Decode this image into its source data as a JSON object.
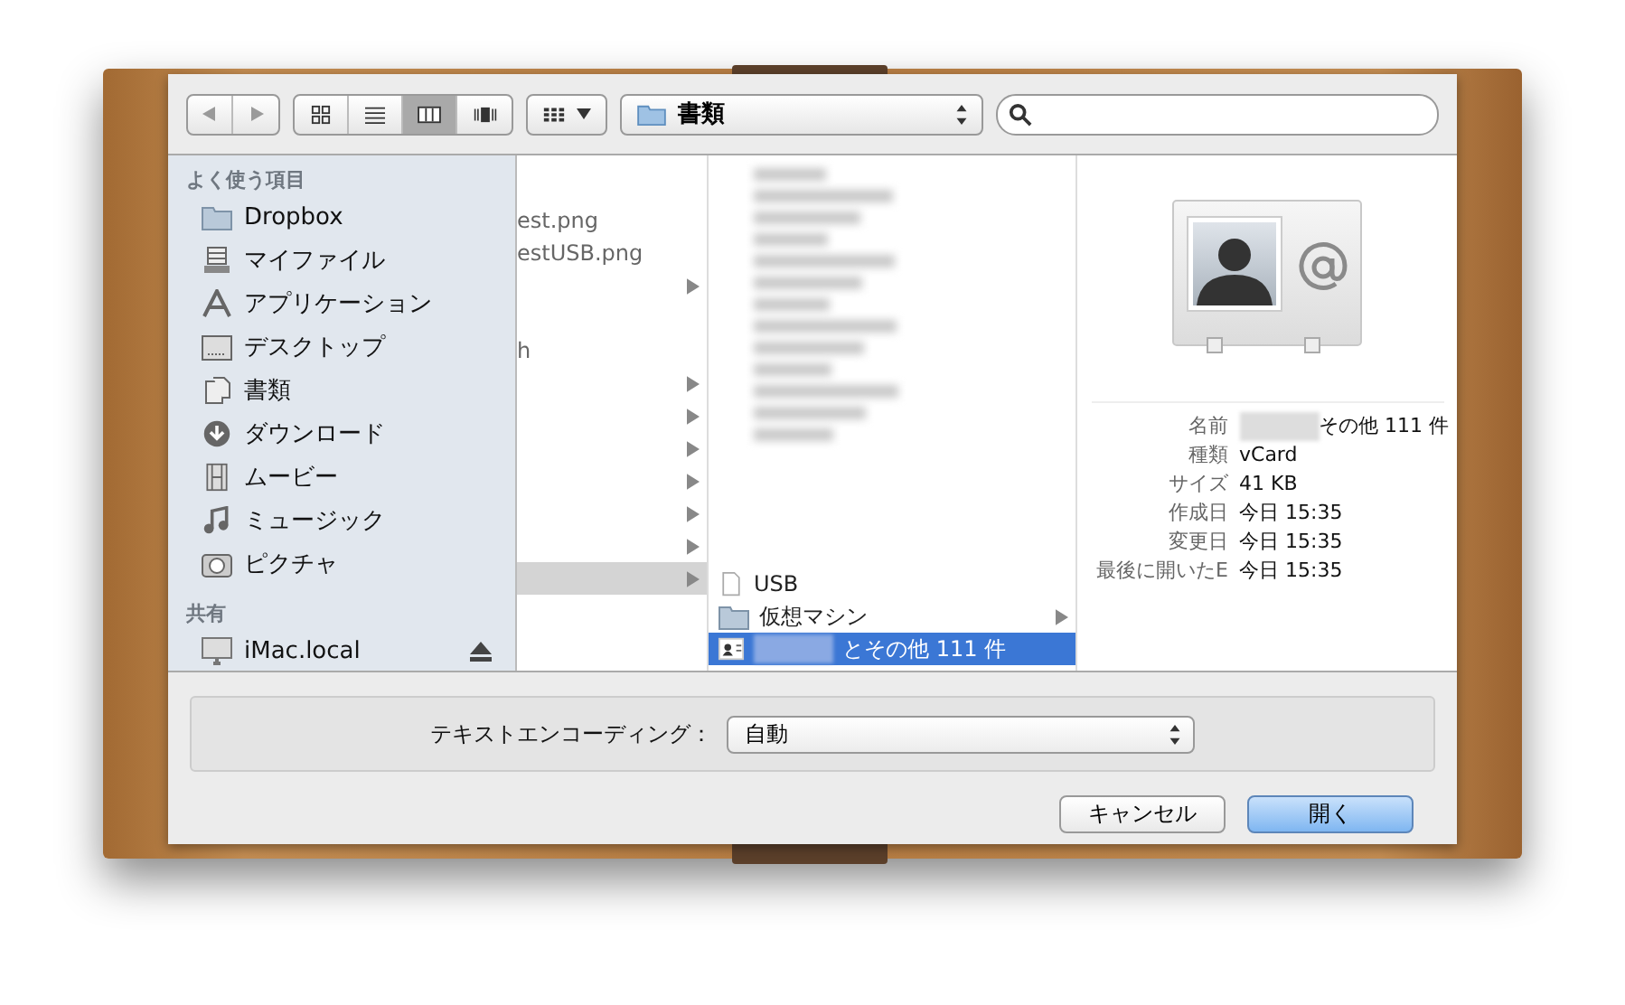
{
  "toolbar": {
    "nav_buttons": [
      {
        "kind": "back",
        "disabled": true
      },
      {
        "kind": "forward",
        "disabled": true
      }
    ],
    "view_modes": [
      {
        "kind": "icons",
        "selected": false
      },
      {
        "kind": "list",
        "selected": false
      },
      {
        "kind": "columns",
        "selected": true
      },
      {
        "kind": "coverflow",
        "selected": false
      }
    ],
    "path_popup": "書類"
  },
  "sidebar": {
    "sections": [
      {
        "title": "よく使う項目",
        "items": [
          {
            "label": "Dropbox",
            "kind": "folder"
          },
          {
            "label": "マイファイル",
            "kind": "myfiles"
          },
          {
            "label": "アプリケーション",
            "kind": "apps"
          },
          {
            "label": "デスクトップ",
            "kind": "desktop"
          },
          {
            "label": "書類",
            "kind": "documents"
          },
          {
            "label": "ダウンロード",
            "kind": "download"
          },
          {
            "label": "ムービー",
            "kind": "movie"
          },
          {
            "label": "ミュージック",
            "kind": "music"
          },
          {
            "label": "ピクチャ",
            "kind": "camera"
          }
        ]
      },
      {
        "title": "共有",
        "items": [
          {
            "label": "iMac.local",
            "kind": "display",
            "eject": true
          }
        ]
      }
    ]
  },
  "columns": [
    {
      "focused": false,
      "items": [
        {
          "kind": "file",
          "text": "est.png",
          "has_arrow": false,
          "selected": false
        },
        {
          "kind": "file",
          "text": "estUSB.png",
          "has_arrow": false,
          "selected": false
        },
        {
          "kind": "file",
          "has_arrow": true,
          "selected": false
        },
        {
          "kind": "blank"
        },
        {
          "kind": "file",
          "text": "h",
          "has_arrow": false,
          "selected": false
        },
        {
          "kind": "file",
          "has_arrow": true,
          "selected": false
        },
        {
          "kind": "file",
          "has_arrow": true,
          "selected": false
        },
        {
          "kind": "file",
          "has_arrow": true,
          "selected": false
        },
        {
          "kind": "file",
          "has_arrow": true,
          "selected": false
        },
        {
          "kind": "file",
          "has_arrow": true,
          "selected": false
        },
        {
          "kind": "file",
          "has_arrow": true,
          "selected": false
        },
        {
          "kind": "file",
          "has_arrow": true,
          "selected": true
        }
      ]
    },
    {
      "focused": true,
      "blurred_rows": true,
      "items": [
        {
          "kind": "document",
          "text": "USB",
          "has_arrow": false,
          "selected": false
        },
        {
          "kind": "folder",
          "text": "仮想マシン",
          "has_arrow": true,
          "selected": false
        },
        {
          "kind": "vcard",
          "text": "とその他 111 件",
          "has_arrow": false,
          "selected": true,
          "blurred_prefix": true
        }
      ]
    }
  ],
  "preview": {
    "fields": [
      {
        "label": "名前",
        "value": "その他 111 件",
        "blurred_prefix": true
      },
      {
        "label": "種類",
        "value": "vCard"
      },
      {
        "label": "サイズ",
        "value": "41 KB"
      },
      {
        "label": "作成日",
        "value": "今日 15:35"
      },
      {
        "label": "変更日",
        "value": "今日 15:35"
      },
      {
        "label": "最後に開いたE",
        "value": "今日 15:35"
      }
    ]
  },
  "encoding": {
    "label": "テキストエンコーディング：",
    "value": "自動"
  },
  "buttons": [
    {
      "label": "キャンセル",
      "kind": "normal"
    },
    {
      "label": "開く",
      "kind": "default"
    }
  ]
}
